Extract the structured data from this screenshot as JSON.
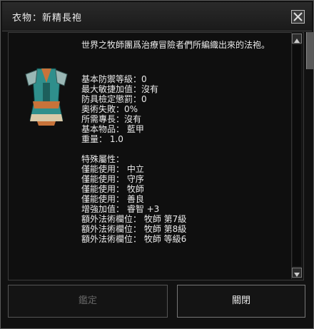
{
  "window": {
    "title": "衣物：新精長袍"
  },
  "description": "世界之牧師團爲治療冒險者們所編織出來的法袍。",
  "stats": [
    "基本防禦等級：0",
    "最大敏捷加值：沒有",
    "防具檢定懲罰：0",
    "奧術失敗：0%",
    "所需專長：沒有",
    "基本物品： 藍甲",
    "重量： 1.0"
  ],
  "properties_header": "特殊屬性：",
  "properties": [
    "僅能使用： 中立",
    "僅能使用： 守序",
    "僅能使用： 牧師",
    "僅能使用： 善良",
    "增強加值： 睿智 +3",
    "額外法術欄位： 牧師 第7級",
    "額外法術欄位： 牧師 第8級",
    "額外法術欄位： 牧師 等級6"
  ],
  "buttons": {
    "identify": "鑑定",
    "close": "關閉"
  },
  "colors": {
    "robe_teal": "#2f8f8c",
    "robe_orange": "#c8733a",
    "disabled_text": "#666666"
  },
  "icons": [
    "close-icon",
    "scroll-up-icon",
    "scroll-down-icon",
    "robe-icon"
  ]
}
